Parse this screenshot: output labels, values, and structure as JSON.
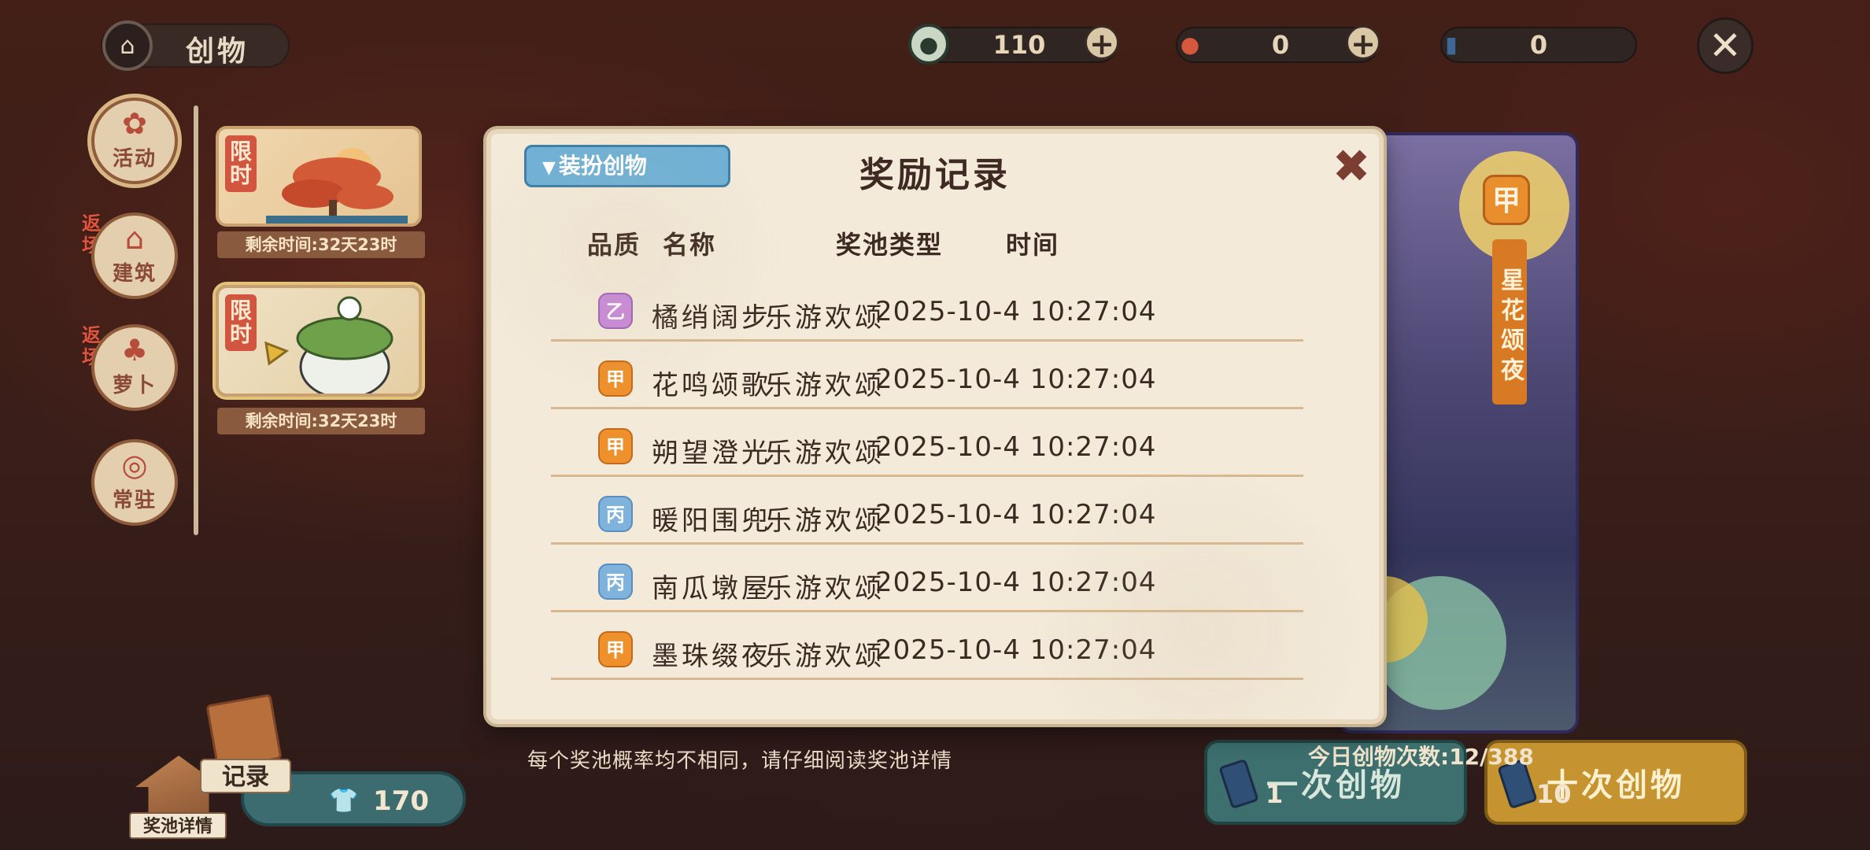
{
  "header": {
    "title": "创物",
    "currencies": [
      {
        "icon": "coin-icon",
        "value": "110",
        "has_plus": true
      },
      {
        "icon": "apple-icon",
        "value": "0",
        "has_plus": true
      },
      {
        "icon": "ticket-icon",
        "value": "0",
        "has_plus": false
      }
    ]
  },
  "sidebar": {
    "tabs": [
      {
        "label": "活动",
        "return_tag": ""
      },
      {
        "label": "建筑",
        "return_tag": "返场"
      },
      {
        "label": "萝卜",
        "return_tag": "返场"
      },
      {
        "label": "常驻",
        "return_tag": ""
      }
    ],
    "banners": [
      {
        "tag": "限时",
        "time_left": "剩余时间:32天23时"
      },
      {
        "tag": "限时",
        "time_left": "剩余时间:32天23时"
      }
    ]
  },
  "preview": {
    "rank": "甲",
    "name": "星花颂夜"
  },
  "modal": {
    "title": "奖励记录",
    "filter_label": "装扮创物",
    "columns": {
      "quality": "品质",
      "name": "名称",
      "pool": "奖池类型",
      "time": "时间"
    },
    "rows": [
      {
        "rank": "乙",
        "rank_class": "yi",
        "name": "橘绡阔步",
        "pool": "乐游欢颂",
        "time": "2025-10-4 10:27:04"
      },
      {
        "rank": "甲",
        "rank_class": "jia",
        "name": "花鸣颂歌",
        "pool": "乐游欢颂",
        "time": "2025-10-4 10:27:04"
      },
      {
        "rank": "甲",
        "rank_class": "jia",
        "name": "朔望澄光",
        "pool": "乐游欢颂",
        "time": "2025-10-4 10:27:04"
      },
      {
        "rank": "丙",
        "rank_class": "bing",
        "name": "暖阳围兜",
        "pool": "乐游欢颂",
        "time": "2025-10-4 10:27:04"
      },
      {
        "rank": "丙",
        "rank_class": "bing",
        "name": "南瓜墩屋",
        "pool": "乐游欢颂",
        "time": "2025-10-4 10:27:04"
      },
      {
        "rank": "甲",
        "rank_class": "jia",
        "name": "墨珠缀夜",
        "pool": "乐游欢颂",
        "time": "2025-10-4 10:27:04"
      }
    ]
  },
  "footer": {
    "prob_note": "每个奖池概率均不相同，请仔细阅读奖池详情",
    "daily_count": "今日创物次数:12/388",
    "draw_one_label": "一次创物",
    "draw_one_cost": "1",
    "draw_ten_label": "十次创物",
    "draw_ten_cost": "10",
    "record_label": "记录",
    "pool_detail_label": "奖池详情",
    "shop_value": "170"
  },
  "colors": {
    "rank_yi": "#c88ad8",
    "rank_jia": "#ee902c",
    "rank_bing": "#7fb3dc",
    "filter_blue": "#6fb1d6"
  }
}
